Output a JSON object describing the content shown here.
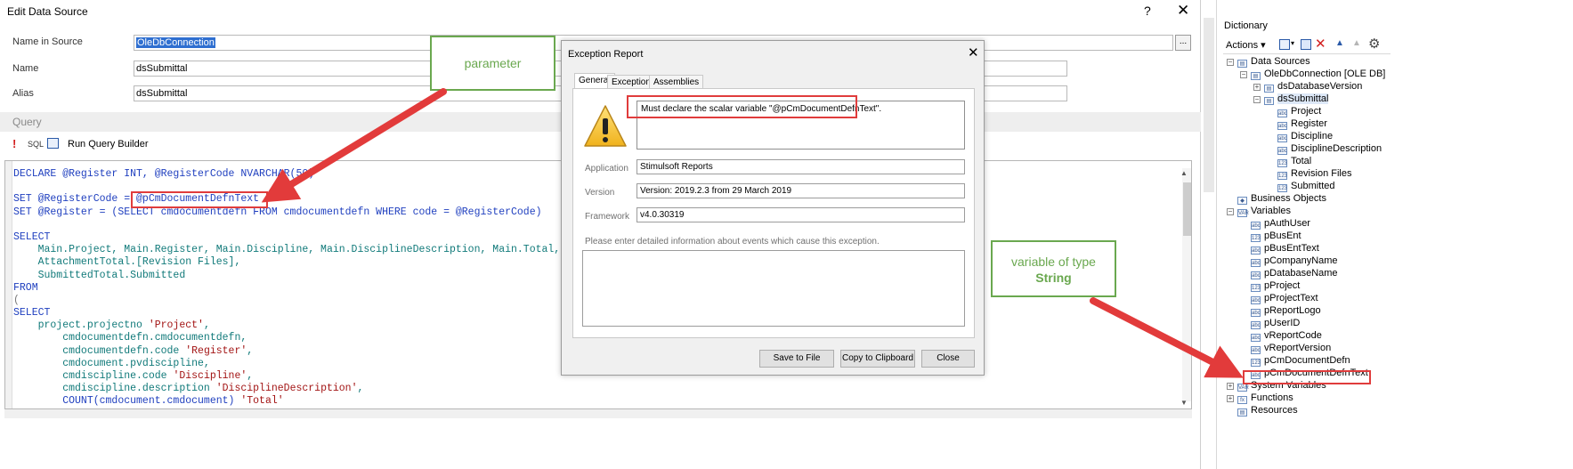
{
  "edit_window": {
    "title": "Edit Data Source",
    "help": "?",
    "close": "✕",
    "fields": {
      "name_in_source_label": "Name in Source",
      "name_in_source_value": "OleDbConnection",
      "browse_button": "...",
      "name_label": "Name",
      "name_value": "dsSubmittal",
      "alias_label": "Alias",
      "alias_value": "dsSubmittal"
    },
    "query": {
      "header": "Query",
      "toolbar": {
        "exclamation": "!",
        "sql": "SQL",
        "run_query_builder": "Run Query Builder"
      },
      "lines": [
        [
          {
            "t": "DECLARE @Register INT, @RegisterCode NVARCHAR(50)",
            "c": "kw"
          }
        ],
        [
          {
            "t": "",
            "c": ""
          }
        ],
        [
          {
            "t": "SET @RegisterCode = @pCmDocumentDefnText",
            "c": "kw"
          }
        ],
        [
          {
            "t": "SET @Register = (SELECT cmdocumentdefn FROM cmdocumentdefn WHERE code = @RegisterCode)",
            "c": "kw"
          }
        ],
        [
          {
            "t": "",
            "c": ""
          }
        ],
        [
          {
            "t": "SELECT",
            "c": "kw"
          }
        ],
        [
          {
            "t": "    Main.Project, Main.Register, Main.Discipline, Main.DisciplineDescription, Main.Total,",
            "c": "nm"
          }
        ],
        [
          {
            "t": "    AttachmentTotal.[Revision Files],",
            "c": "nm"
          }
        ],
        [
          {
            "t": "    SubmittedTotal.Submitted",
            "c": "nm"
          }
        ],
        [
          {
            "t": "FROM",
            "c": "kw"
          }
        ],
        [
          {
            "t": "(",
            "c": "op"
          }
        ],
        [
          {
            "t": "SELECT",
            "c": "kw"
          }
        ],
        [
          {
            "t": "    project.projectno ",
            "c": "nm"
          },
          {
            "t": "'Project'",
            "c": "str"
          },
          {
            "t": ",",
            "c": "nm"
          }
        ],
        [
          {
            "t": "        cmdocumentdefn.cmdocumentdefn,",
            "c": "nm"
          }
        ],
        [
          {
            "t": "        cmdocumentdefn.code ",
            "c": "nm"
          },
          {
            "t": "'Register'",
            "c": "str"
          },
          {
            "t": ",",
            "c": "nm"
          }
        ],
        [
          {
            "t": "        cmdocument.pvdiscipline,",
            "c": "nm"
          }
        ],
        [
          {
            "t": "        cmdiscipline.code ",
            "c": "nm"
          },
          {
            "t": "'Discipline'",
            "c": "str"
          },
          {
            "t": ",",
            "c": "nm"
          }
        ],
        [
          {
            "t": "        cmdiscipline.description ",
            "c": "nm"
          },
          {
            "t": "'DisciplineDescription'",
            "c": "str"
          },
          {
            "t": ",",
            "c": "nm"
          }
        ],
        [
          {
            "t": "        COUNT(cmdocument.cmdocument) ",
            "c": "kw"
          },
          {
            "t": "'Total'",
            "c": "str"
          }
        ]
      ]
    }
  },
  "exception_dialog": {
    "title": "Exception Report",
    "close": "✕",
    "tabs": [
      "General",
      "Exception",
      "Assemblies"
    ],
    "message": "Must declare the scalar variable \"@pCmDocumentDefnText\".",
    "application_label": "Application",
    "application_value": "Stimulsoft Reports",
    "version_label": "Version",
    "version_value": "Version: 2019.2.3 from 29 March 2019",
    "framework_label": "Framework",
    "framework_value": "v4.0.30319",
    "details_prompt": "Please enter detailed information about events which cause this exception.",
    "buttons": {
      "save": "Save to File",
      "copy": "Copy to Clipboard",
      "close": "Close"
    }
  },
  "dictionary": {
    "title": "Dictionary",
    "actions": "Actions",
    "tree": [
      {
        "level": 0,
        "exp": "−",
        "ico": "db",
        "label": "Data Sources"
      },
      {
        "level": 1,
        "exp": "−",
        "ico": "db",
        "label": "OleDbConnection [OLE DB]"
      },
      {
        "level": 2,
        "exp": "+",
        "ico": "tb",
        "label": "dsDatabaseVersion"
      },
      {
        "level": 2,
        "exp": "−",
        "ico": "tb",
        "label": "dsSubmittal",
        "selected": true
      },
      {
        "level": 3,
        "exp": "",
        "ico": "abc",
        "label": "Project"
      },
      {
        "level": 3,
        "exp": "",
        "ico": "abc",
        "label": "Register"
      },
      {
        "level": 3,
        "exp": "",
        "ico": "abc",
        "label": "Discipline"
      },
      {
        "level": 3,
        "exp": "",
        "ico": "abc",
        "label": "DisciplineDescription"
      },
      {
        "level": 3,
        "exp": "",
        "ico": "123",
        "label": "Total"
      },
      {
        "level": 3,
        "exp": "",
        "ico": "123",
        "label": "Revision Files"
      },
      {
        "level": 3,
        "exp": "",
        "ico": "123",
        "label": "Submitted"
      },
      {
        "level": 0,
        "exp": "",
        "ico": "bo",
        "label": "Business Objects"
      },
      {
        "level": 0,
        "exp": "−",
        "ico": "var",
        "label": "Variables"
      },
      {
        "level": 1,
        "exp": "",
        "ico": "abc",
        "label": "pAuthUser"
      },
      {
        "level": 1,
        "exp": "",
        "ico": "123",
        "label": "pBusEnt"
      },
      {
        "level": 1,
        "exp": "",
        "ico": "abc",
        "label": "pBusEntText"
      },
      {
        "level": 1,
        "exp": "",
        "ico": "abc",
        "label": "pCompanyName"
      },
      {
        "level": 1,
        "exp": "",
        "ico": "abc",
        "label": "pDatabaseName"
      },
      {
        "level": 1,
        "exp": "",
        "ico": "123",
        "label": "pProject"
      },
      {
        "level": 1,
        "exp": "",
        "ico": "abc",
        "label": "pProjectText"
      },
      {
        "level": 1,
        "exp": "",
        "ico": "abc",
        "label": "pReportLogo"
      },
      {
        "level": 1,
        "exp": "",
        "ico": "abc",
        "label": "pUserID"
      },
      {
        "level": 1,
        "exp": "",
        "ico": "abc",
        "label": "vReportCode"
      },
      {
        "level": 1,
        "exp": "",
        "ico": "abc",
        "label": "vReportVersion"
      },
      {
        "level": 1,
        "exp": "",
        "ico": "123",
        "label": "pCmDocumentDefn"
      },
      {
        "level": 1,
        "exp": "",
        "ico": "abc",
        "label": "pCmDocumentDefnText"
      },
      {
        "level": 0,
        "exp": "+",
        "ico": "var",
        "label": "System Variables"
      },
      {
        "level": 0,
        "exp": "+",
        "ico": "fx",
        "label": "Functions"
      },
      {
        "level": 0,
        "exp": "",
        "ico": "db",
        "label": "Resources"
      }
    ]
  },
  "annotations": {
    "parameter": "parameter",
    "variable_line1": "variable of type",
    "variable_line2": "String"
  }
}
